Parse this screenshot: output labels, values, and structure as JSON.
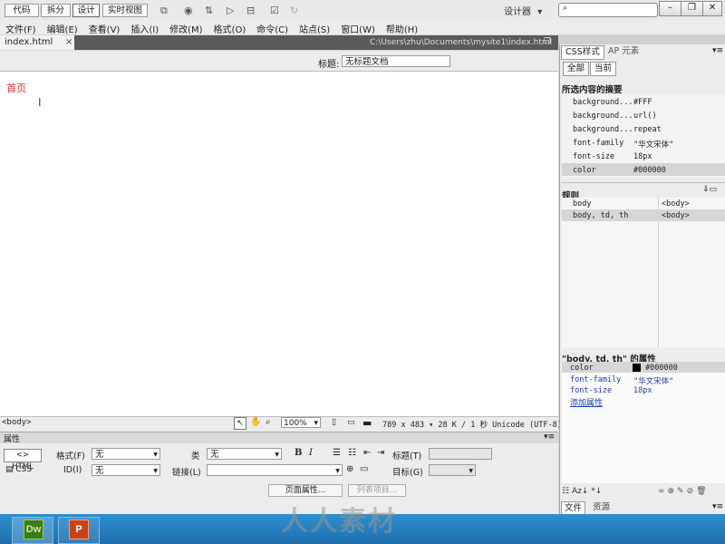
{
  "app": {
    "logo": "Dw",
    "workspace": "设计器",
    "workspace_arrow": "▾"
  },
  "menubar": [
    "文件(F)",
    "编辑(E)",
    "查看(V)",
    "插入(I)",
    "修改(M)",
    "格式(O)",
    "命令(C)",
    "站点(S)",
    "窗口(W)",
    "帮助(H)"
  ],
  "document": {
    "tab": "index.html",
    "tab_close": "×",
    "path": "C:\\Users\\zhu\\Documents\\mysite1\\index.html",
    "view_buttons": [
      "代码",
      "拆分",
      "设计",
      "实时视图"
    ],
    "active_view": "设计",
    "title_label": "标题:",
    "title_value": "无标题文档",
    "content_text": "首页"
  },
  "statusbar": {
    "tag": "<body>",
    "zoom": "100%",
    "info": "789 x 483 ▾ 28 K / 1 秒 Unicode (UTF-8)"
  },
  "properties": {
    "header": "属性",
    "html_btn": "<> HTML",
    "css_btn": "CSS",
    "format_label": "格式(F)",
    "format_value": "无",
    "id_label": "ID(I)",
    "id_value": "无",
    "class_label": "类",
    "class_value": "无",
    "bold": "B",
    "italic": "I",
    "title_label": "标题(T)",
    "link_label": "链接(L)",
    "target_label": "目标(G)",
    "page_props_btn": "页面属性...",
    "list_item_btn": "列表项目..."
  },
  "rpanel": {
    "tabs": [
      "CSS样式",
      "AP 元素"
    ],
    "mode_buttons": [
      "全部",
      "当前"
    ],
    "summary_title": "所选内容的摘要",
    "summary": [
      {
        "prop": "background...",
        "value": "#FFF"
      },
      {
        "prop": "background...",
        "value": "url()"
      },
      {
        "prop": "background...",
        "value": "repeat"
      },
      {
        "prop": "font-family",
        "value": "\"华文宋体\""
      },
      {
        "prop": "font-size",
        "value": "18px"
      },
      {
        "prop": "color",
        "value": "#000000"
      }
    ],
    "rules_title": "规则",
    "rules": [
      {
        "selector": "body",
        "tag": "<body>"
      },
      {
        "selector": "body, td, th",
        "tag": "<body>"
      }
    ],
    "props_title": "\"body, td, th\" 的属性",
    "props": [
      {
        "prop": "color",
        "value": "#000000"
      },
      {
        "prop": "font-family",
        "value": "\"华文宋体\""
      },
      {
        "prop": "font-size",
        "value": "18px"
      }
    ],
    "add_prop": "添加属性",
    "bottom_tabs": [
      "文件",
      "资源"
    ]
  },
  "taskbar": {
    "apps": [
      "Dw",
      "P"
    ]
  },
  "watermark": "人人素材",
  "colors": {
    "accent_red": "#e03030",
    "link_blue": "#1c3fa8",
    "taskbar": "#2e8fcf"
  }
}
